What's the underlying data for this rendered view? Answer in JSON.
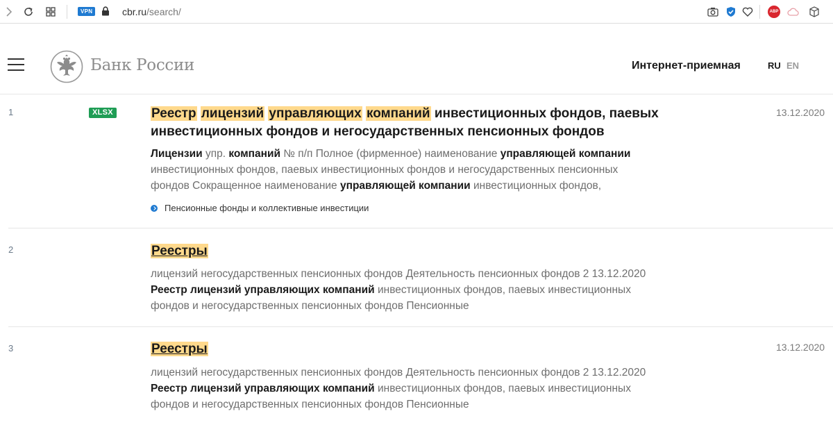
{
  "browser": {
    "vpn_label": "VPN",
    "url_domain": "cbr.ru",
    "url_path": "/search/",
    "abp_label": "ABP"
  },
  "header": {
    "logo_text": "Банк России",
    "reception_link": "Интернет-приемная",
    "lang_ru": "RU",
    "lang_en": "EN"
  },
  "results": [
    {
      "num": "1",
      "badge": "XLSX",
      "date": "13.12.2020",
      "title_parts": [
        "Реестр",
        " ",
        "лицензий",
        " ",
        "управляющих",
        " ",
        "компаний",
        " инвестиционных фондов, паевых инвестиционных фондов и негосударственных пенсионных фондов"
      ],
      "snippet_line1": [
        "Лицензии",
        " упр. ",
        "компаний",
        " № п/п Полное (фирменное) наименование ",
        "управляющей компании"
      ],
      "snippet_line2": "инвестиционных фондов, паевых инвестиционных фондов и негосударственных пенсионных",
      "snippet_line3": [
        "фондов Сокращенное наименование ",
        "управляющей компании",
        " инвестиционных фондов,"
      ],
      "tag": "Пенсионные фонды и коллективные инвестиции"
    },
    {
      "num": "2",
      "title": "Реестры",
      "snippet_line1": "лицензий негосударственных пенсионных фондов Деятельность пенсионных фондов 2 13.12.2020",
      "snippet_line2": [
        "Реестр лицензий управляющих компаний",
        " инвестиционных фондов, паевых инвестиционных"
      ],
      "snippet_line3": "фондов и негосударственных пенсионных фондов Пенсионные"
    },
    {
      "num": "3",
      "date": "13.12.2020",
      "title": "Реестры",
      "snippet_line1": "лицензий негосударственных пенсионных фондов Деятельность пенсионных фондов 2 13.12.2020",
      "snippet_line2": [
        "Реестр лицензий управляющих компаний",
        " инвестиционных фондов, паевых инвестиционных"
      ],
      "snippet_line3": "фондов и негосударственных пенсионных фондов Пенсионные"
    }
  ],
  "colors": {
    "highlight": "#ffd98c",
    "badge_green": "#1f9d55",
    "accent_blue": "#1f7ad1"
  }
}
